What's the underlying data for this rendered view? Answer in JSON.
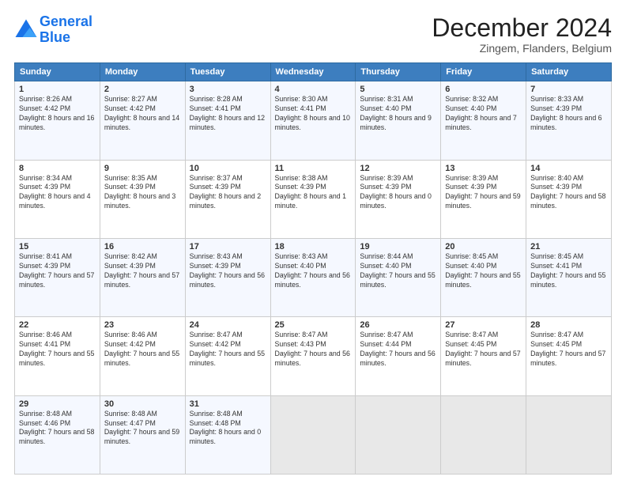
{
  "logo": {
    "line1": "General",
    "line2": "Blue"
  },
  "title": "December 2024",
  "subtitle": "Zingem, Flanders, Belgium",
  "headers": [
    "Sunday",
    "Monday",
    "Tuesday",
    "Wednesday",
    "Thursday",
    "Friday",
    "Saturday"
  ],
  "weeks": [
    [
      {
        "day": "1",
        "sunrise": "Sunrise: 8:26 AM",
        "sunset": "Sunset: 4:42 PM",
        "daylight": "Daylight: 8 hours and 16 minutes."
      },
      {
        "day": "2",
        "sunrise": "Sunrise: 8:27 AM",
        "sunset": "Sunset: 4:42 PM",
        "daylight": "Daylight: 8 hours and 14 minutes."
      },
      {
        "day": "3",
        "sunrise": "Sunrise: 8:28 AM",
        "sunset": "Sunset: 4:41 PM",
        "daylight": "Daylight: 8 hours and 12 minutes."
      },
      {
        "day": "4",
        "sunrise": "Sunrise: 8:30 AM",
        "sunset": "Sunset: 4:41 PM",
        "daylight": "Daylight: 8 hours and 10 minutes."
      },
      {
        "day": "5",
        "sunrise": "Sunrise: 8:31 AM",
        "sunset": "Sunset: 4:40 PM",
        "daylight": "Daylight: 8 hours and 9 minutes."
      },
      {
        "day": "6",
        "sunrise": "Sunrise: 8:32 AM",
        "sunset": "Sunset: 4:40 PM",
        "daylight": "Daylight: 8 hours and 7 minutes."
      },
      {
        "day": "7",
        "sunrise": "Sunrise: 8:33 AM",
        "sunset": "Sunset: 4:39 PM",
        "daylight": "Daylight: 8 hours and 6 minutes."
      }
    ],
    [
      {
        "day": "8",
        "sunrise": "Sunrise: 8:34 AM",
        "sunset": "Sunset: 4:39 PM",
        "daylight": "Daylight: 8 hours and 4 minutes."
      },
      {
        "day": "9",
        "sunrise": "Sunrise: 8:35 AM",
        "sunset": "Sunset: 4:39 PM",
        "daylight": "Daylight: 8 hours and 3 minutes."
      },
      {
        "day": "10",
        "sunrise": "Sunrise: 8:37 AM",
        "sunset": "Sunset: 4:39 PM",
        "daylight": "Daylight: 8 hours and 2 minutes."
      },
      {
        "day": "11",
        "sunrise": "Sunrise: 8:38 AM",
        "sunset": "Sunset: 4:39 PM",
        "daylight": "Daylight: 8 hours and 1 minute."
      },
      {
        "day": "12",
        "sunrise": "Sunrise: 8:39 AM",
        "sunset": "Sunset: 4:39 PM",
        "daylight": "Daylight: 8 hours and 0 minutes."
      },
      {
        "day": "13",
        "sunrise": "Sunrise: 8:39 AM",
        "sunset": "Sunset: 4:39 PM",
        "daylight": "Daylight: 7 hours and 59 minutes."
      },
      {
        "day": "14",
        "sunrise": "Sunrise: 8:40 AM",
        "sunset": "Sunset: 4:39 PM",
        "daylight": "Daylight: 7 hours and 58 minutes."
      }
    ],
    [
      {
        "day": "15",
        "sunrise": "Sunrise: 8:41 AM",
        "sunset": "Sunset: 4:39 PM",
        "daylight": "Daylight: 7 hours and 57 minutes."
      },
      {
        "day": "16",
        "sunrise": "Sunrise: 8:42 AM",
        "sunset": "Sunset: 4:39 PM",
        "daylight": "Daylight: 7 hours and 57 minutes."
      },
      {
        "day": "17",
        "sunrise": "Sunrise: 8:43 AM",
        "sunset": "Sunset: 4:39 PM",
        "daylight": "Daylight: 7 hours and 56 minutes."
      },
      {
        "day": "18",
        "sunrise": "Sunrise: 8:43 AM",
        "sunset": "Sunset: 4:40 PM",
        "daylight": "Daylight: 7 hours and 56 minutes."
      },
      {
        "day": "19",
        "sunrise": "Sunrise: 8:44 AM",
        "sunset": "Sunset: 4:40 PM",
        "daylight": "Daylight: 7 hours and 55 minutes."
      },
      {
        "day": "20",
        "sunrise": "Sunrise: 8:45 AM",
        "sunset": "Sunset: 4:40 PM",
        "daylight": "Daylight: 7 hours and 55 minutes."
      },
      {
        "day": "21",
        "sunrise": "Sunrise: 8:45 AM",
        "sunset": "Sunset: 4:41 PM",
        "daylight": "Daylight: 7 hours and 55 minutes."
      }
    ],
    [
      {
        "day": "22",
        "sunrise": "Sunrise: 8:46 AM",
        "sunset": "Sunset: 4:41 PM",
        "daylight": "Daylight: 7 hours and 55 minutes."
      },
      {
        "day": "23",
        "sunrise": "Sunrise: 8:46 AM",
        "sunset": "Sunset: 4:42 PM",
        "daylight": "Daylight: 7 hours and 55 minutes."
      },
      {
        "day": "24",
        "sunrise": "Sunrise: 8:47 AM",
        "sunset": "Sunset: 4:42 PM",
        "daylight": "Daylight: 7 hours and 55 minutes."
      },
      {
        "day": "25",
        "sunrise": "Sunrise: 8:47 AM",
        "sunset": "Sunset: 4:43 PM",
        "daylight": "Daylight: 7 hours and 56 minutes."
      },
      {
        "day": "26",
        "sunrise": "Sunrise: 8:47 AM",
        "sunset": "Sunset: 4:44 PM",
        "daylight": "Daylight: 7 hours and 56 minutes."
      },
      {
        "day": "27",
        "sunrise": "Sunrise: 8:47 AM",
        "sunset": "Sunset: 4:45 PM",
        "daylight": "Daylight: 7 hours and 57 minutes."
      },
      {
        "day": "28",
        "sunrise": "Sunrise: 8:47 AM",
        "sunset": "Sunset: 4:45 PM",
        "daylight": "Daylight: 7 hours and 57 minutes."
      }
    ],
    [
      {
        "day": "29",
        "sunrise": "Sunrise: 8:48 AM",
        "sunset": "Sunset: 4:46 PM",
        "daylight": "Daylight: 7 hours and 58 minutes."
      },
      {
        "day": "30",
        "sunrise": "Sunrise: 8:48 AM",
        "sunset": "Sunset: 4:47 PM",
        "daylight": "Daylight: 7 hours and 59 minutes."
      },
      {
        "day": "31",
        "sunrise": "Sunrise: 8:48 AM",
        "sunset": "Sunset: 4:48 PM",
        "daylight": "Daylight: 8 hours and 0 minutes."
      },
      null,
      null,
      null,
      null
    ]
  ]
}
